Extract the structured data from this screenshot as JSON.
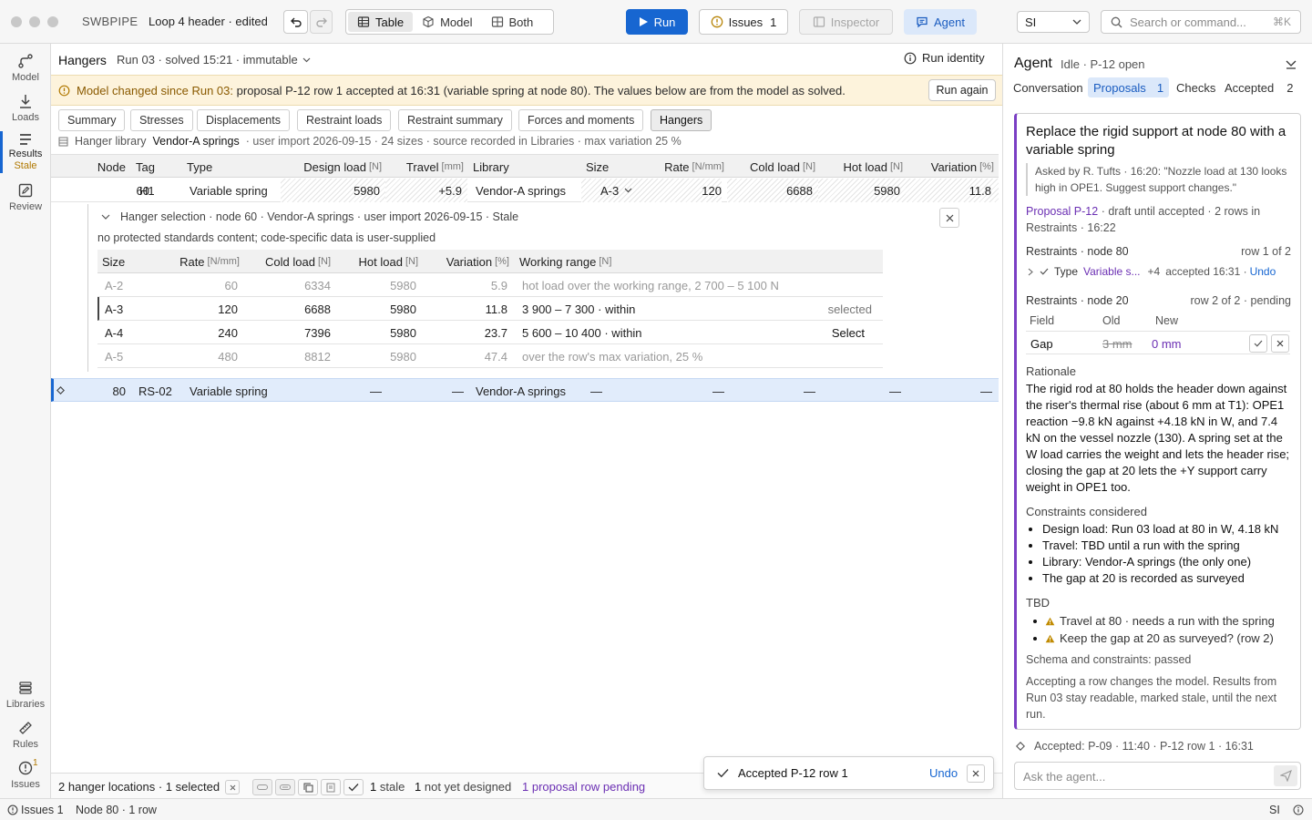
{
  "app": {
    "name": "SWBPIPE",
    "doc": "Loop 4 header · edited"
  },
  "toolbar": {
    "view_table": "Table",
    "view_model": "Model",
    "view_both": "Both",
    "run": "Run",
    "issues": "Issues",
    "issues_count": "1",
    "inspector": "Inspector",
    "agent": "Agent",
    "units": "SI",
    "search_placeholder": "Search or command...",
    "search_shortcut": "⌘K"
  },
  "rail": {
    "model": "Model",
    "loads": "Loads",
    "results": "Results",
    "results_state": "Stale",
    "review": "Review",
    "libraries": "Libraries",
    "rules": "Rules",
    "issues": "Issues",
    "issues_badge": "1"
  },
  "results": {
    "title": "Hangers",
    "run_label": "Run 03 · solved 15:21 · immutable",
    "run_identity": "Run identity",
    "banner_strong": "Model changed since Run 03:",
    "banner_text": "proposal P-12 row 1 accepted at 16:31 (variable spring at node 80). The values below are from the model as solved.",
    "run_again": "Run again",
    "tabs": [
      "Summary",
      "Stresses",
      "Displacements",
      "Restraint loads",
      "Restraint summary",
      "Forces and moments",
      "Hangers"
    ],
    "library_label": "Hanger library",
    "library_name": "Vendor-A springs",
    "library_meta": "· user import 2026-09-15 · 24 sizes · source recorded in Libraries · max variation 25 %",
    "columns": {
      "node": "Node",
      "tag": "Tag",
      "type": "Type",
      "design": "Design load",
      "design_u": "[N]",
      "travel": "Travel",
      "travel_u": "[mm]",
      "library": "Library",
      "size": "Size",
      "rate": "Rate",
      "rate_u": "[N/mm]",
      "cold": "Cold load",
      "cold_u": "[N]",
      "hot": "Hot load",
      "hot_u": "[N]",
      "variation": "Variation",
      "variation_u": "[%]"
    },
    "row1": {
      "node": "60",
      "tag": "H1",
      "type": "Variable spring",
      "design": "5980",
      "travel": "+5.9",
      "library": "Vendor-A springs",
      "size": "A-3",
      "rate": "120",
      "cold": "6688",
      "hot": "5980",
      "variation": "11.8"
    },
    "selection": {
      "title": "Hanger selection · node 60 · Vendor-A springs · user import 2026-09-15 · Stale",
      "note": "no protected standards content; code-specific data is user-supplied",
      "headers": {
        "size": "Size",
        "rate": "Rate",
        "rate_u": "[N/mm]",
        "cold": "Cold load",
        "cold_u": "[N]",
        "hot": "Hot load",
        "hot_u": "[N]",
        "var": "Variation",
        "var_u": "[%]",
        "range": "Working range",
        "range_u": "[N]"
      },
      "rows": [
        {
          "size": "A-2",
          "rate": "60",
          "cold": "6334",
          "hot": "5980",
          "var": "5.9",
          "range": "hot load over the working range, 2 700 – 5 100 N",
          "action": ""
        },
        {
          "size": "A-3",
          "rate": "120",
          "cold": "6688",
          "hot": "5980",
          "var": "11.8",
          "range": "3 900 – 7 300 · within",
          "action": "selected"
        },
        {
          "size": "A-4",
          "rate": "240",
          "cold": "7396",
          "hot": "5980",
          "var": "23.7",
          "range": "5 600 – 10 400 · within",
          "action": "Select"
        },
        {
          "size": "A-5",
          "rate": "480",
          "cold": "8812",
          "hot": "5980",
          "var": "47.4",
          "range": "over the row's max variation, 25 %",
          "action": ""
        }
      ]
    },
    "row2": {
      "node": "80",
      "tag": "RS-02",
      "type": "Variable spring",
      "design": "—",
      "travel": "—",
      "library": "Vendor-A springs",
      "size": "—",
      "rate": "—",
      "cold": "—",
      "hot": "—",
      "variation": "—"
    },
    "footer": {
      "locations": "2 hanger locations · 1 selected",
      "stale_n": "1",
      "stale": "stale",
      "notdesigned_n": "1",
      "notdesigned": "not yet designed",
      "pending": "1 proposal row pending"
    }
  },
  "agent": {
    "title": "Agent",
    "state": "Idle · P-12 open",
    "tabs": {
      "conversation": "Conversation",
      "proposals": "Proposals",
      "proposals_n": "1",
      "checks": "Checks",
      "accepted": "Accepted",
      "accepted_n": "2"
    },
    "card_title": "Replace the rigid support at node 80 with a variable spring",
    "quote": "Asked by R. Tufts · 16:20: \"Nozzle load at 130 looks high in OPE1. Suggest support changes.\"",
    "proposal_id": "Proposal P-12",
    "proposal_meta": "· draft until accepted · 2 rows in Restraints · 16:22",
    "r1_title": "Restraints · node 80",
    "r1_meta": "row 1 of 2",
    "r1_field": "Type",
    "r1_value": "Variable s...",
    "r1_more": "+4",
    "r1_accepted": "accepted 16:31 ·",
    "r1_undo": "Undo",
    "r2_title": "Restraints · node 20",
    "r2_meta": "row 2 of 2 · pending",
    "r2_h_field": "Field",
    "r2_h_old": "Old",
    "r2_h_new": "New",
    "r2_field": "Gap",
    "r2_old": "3 mm",
    "r2_new": "0 mm",
    "rationale_h": "Rationale",
    "rationale": "The rigid rod at 80 holds the header down against the riser's thermal rise (about 6 mm at T1): OPE1 reaction −9.8 kN against +4.18 kN in W, and 7.4 kN on the vessel nozzle (130). A spring set at the W load carries the weight and lets the header rise; closing the gap at 20 lets the +Y support carry weight in OPE1 too.",
    "constraints_h": "Constraints considered",
    "constraints": [
      "Design load: Run 03 load at 80 in W, 4.18 kN",
      "Travel: TBD until a run with the spring",
      "Library: Vendor-A springs (the only one)",
      "The gap at 20 is recorded as surveyed"
    ],
    "tbd_h": "TBD",
    "tbd": [
      "Travel at 80 · needs a run with the spring",
      "Keep the gap at 20 as surveyed? (row 2)"
    ],
    "schema": "Schema and constraints: passed",
    "note": "Accepting a row changes the model. Results from Run 03 stay readable, marked stale, until the next run.",
    "history": "Accepted: P-09 · 11:40 · P-12 row 1 · 16:31",
    "ask_placeholder": "Ask the agent..."
  },
  "toast": {
    "text": "Accepted P-12 row 1",
    "undo": "Undo"
  },
  "status": {
    "issues": "Issues 1",
    "node": "Node 80 · 1 row",
    "units": "SI"
  }
}
